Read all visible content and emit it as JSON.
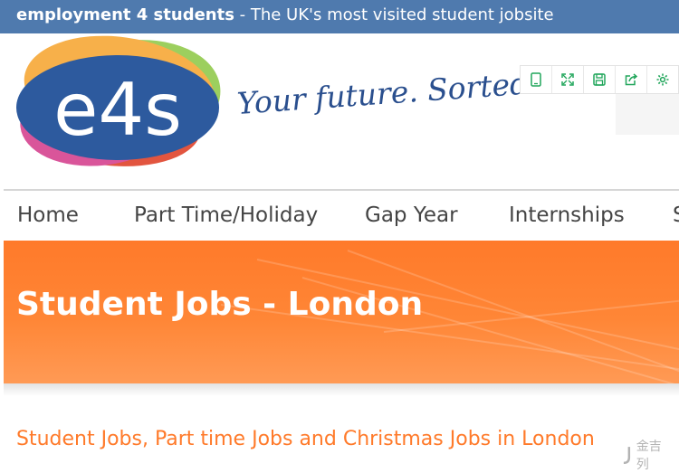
{
  "topbar": {
    "brand": "employment 4 students",
    "tagline": " - The UK's most visited student jobsite"
  },
  "logo": {
    "text": "e4s",
    "slogan": "Your future. Sorted."
  },
  "toolbar": {
    "icons": [
      "tablet-icon",
      "fullscreen-icon",
      "save-icon",
      "share-icon",
      "settings-icon"
    ]
  },
  "nav": {
    "items": [
      "Home",
      "Part Time/Holiday",
      "Gap Year",
      "Internships",
      "S"
    ]
  },
  "banner": {
    "title": "Student Jobs - London"
  },
  "content": {
    "subheading": "Student Jobs, Part time Jobs and Christmas Jobs in London"
  },
  "watermark": {
    "text": "金吉列"
  },
  "colors": {
    "topbar": "#4f7aae",
    "accent_orange": "#ff7a2a",
    "logo_blue": "#2d5a9e",
    "toolbar_green": "#21a65b"
  }
}
